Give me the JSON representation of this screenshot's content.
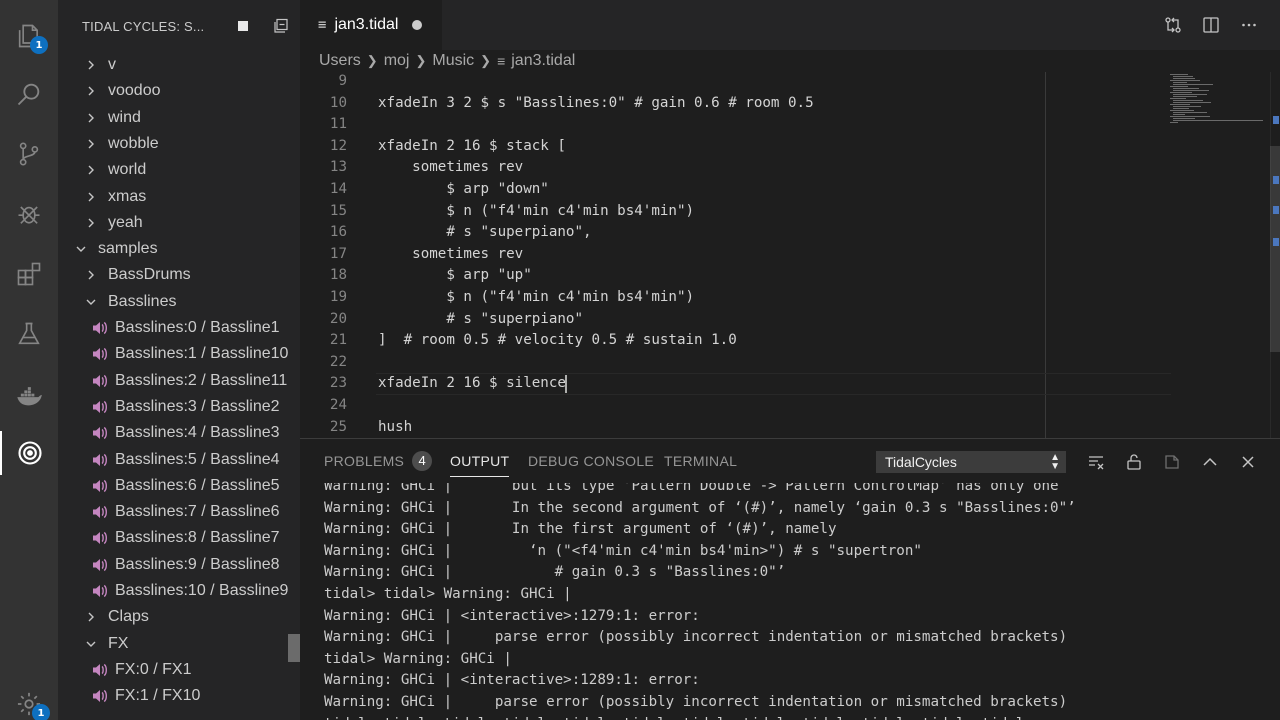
{
  "activity_bar": {
    "explorer_badge": "1",
    "settings_badge": "1",
    "icons": [
      "files-icon",
      "search-icon",
      "source-control-icon",
      "debug-icon",
      "extensions-icon",
      "testing-icon",
      "docker-icon",
      "tidal-icon",
      "settings-icon"
    ]
  },
  "sidebar": {
    "title": "TIDAL CYCLES: S...",
    "items": [
      {
        "label": "v",
        "kind": "folder-collapsed"
      },
      {
        "label": "voodoo",
        "kind": "folder-collapsed"
      },
      {
        "label": "wind",
        "kind": "folder-collapsed"
      },
      {
        "label": "wobble",
        "kind": "folder-collapsed"
      },
      {
        "label": "world",
        "kind": "folder-collapsed"
      },
      {
        "label": "xmas",
        "kind": "folder-collapsed"
      },
      {
        "label": "yeah",
        "kind": "folder-collapsed"
      },
      {
        "label": "samples",
        "kind": "folder-expanded-root"
      },
      {
        "label": "BassDrums",
        "kind": "folder-collapsed"
      },
      {
        "label": "Basslines",
        "kind": "folder-expanded"
      },
      {
        "label": "Basslines:0 / Bassline1",
        "kind": "sound"
      },
      {
        "label": "Basslines:1 / Bassline10",
        "kind": "sound"
      },
      {
        "label": "Basslines:2 / Bassline11",
        "kind": "sound"
      },
      {
        "label": "Basslines:3 / Bassline2",
        "kind": "sound"
      },
      {
        "label": "Basslines:4 / Bassline3",
        "kind": "sound"
      },
      {
        "label": "Basslines:5 / Bassline4",
        "kind": "sound"
      },
      {
        "label": "Basslines:6 / Bassline5",
        "kind": "sound"
      },
      {
        "label": "Basslines:7 / Bassline6",
        "kind": "sound"
      },
      {
        "label": "Basslines:8 / Bassline7",
        "kind": "sound"
      },
      {
        "label": "Basslines:9 / Bassline8",
        "kind": "sound"
      },
      {
        "label": "Basslines:10 / Bassline9",
        "kind": "sound"
      },
      {
        "label": "Claps",
        "kind": "folder-collapsed"
      },
      {
        "label": "FX",
        "kind": "folder-expanded"
      },
      {
        "label": "FX:0 / FX1",
        "kind": "sound"
      },
      {
        "label": "FX:1 / FX10",
        "kind": "sound"
      }
    ]
  },
  "editor": {
    "tab_label": "jan3.tidal",
    "breadcrumbs": [
      "Users",
      "moj",
      "Music",
      "jan3.tidal"
    ],
    "lines": [
      {
        "n": "9",
        "text": ""
      },
      {
        "n": "10",
        "text": "xfadeIn 3 2 $ s \"Basslines:0\" # gain 0.6 # room 0.5"
      },
      {
        "n": "11",
        "text": ""
      },
      {
        "n": "12",
        "text": "xfadeIn 2 16 $ stack ["
      },
      {
        "n": "13",
        "text": "    sometimes rev"
      },
      {
        "n": "14",
        "text": "        $ arp \"down\""
      },
      {
        "n": "15",
        "text": "        $ n (\"f4'min c4'min bs4'min\")"
      },
      {
        "n": "16",
        "text": "        # s \"superpiano\","
      },
      {
        "n": "17",
        "text": "    sometimes rev"
      },
      {
        "n": "18",
        "text": "        $ arp \"up\""
      },
      {
        "n": "19",
        "text": "        $ n (\"f4'min c4'min bs4'min\")"
      },
      {
        "n": "20",
        "text": "        # s \"superpiano\""
      },
      {
        "n": "21",
        "text": "]  # room 0.5 # velocity 0.5 # sustain 1.0"
      },
      {
        "n": "22",
        "text": ""
      },
      {
        "n": "23",
        "text": "xfadeIn 2 16 $ silence"
      },
      {
        "n": "24",
        "text": ""
      },
      {
        "n": "25",
        "text": "hush"
      }
    ]
  },
  "panel": {
    "tabs": {
      "problems": "PROBLEMS",
      "problems_count": "4",
      "output": "OUTPUT",
      "debug_console": "DEBUG CONSOLE",
      "terminal": "TERMINAL"
    },
    "channel": "TidalCycles",
    "output_lines": [
      "Warning: GHCi |       but its type ‘Pattern Double -> Pattern ControlMap’ has only one",
      "Warning: GHCi |       In the second argument of ‘(#)’, namely ‘gain 0.3 s \"Basslines:0\"’",
      "Warning: GHCi |       In the first argument of ‘(#)’, namely",
      "Warning: GHCi |         ‘n (\"<f4'min c4'min bs4'min>\") # s \"supertron\"",
      "Warning: GHCi |            # gain 0.3 s \"Basslines:0\"’",
      "tidal> tidal> Warning: GHCi |",
      "Warning: GHCi | <interactive>:1279:1: error:",
      "Warning: GHCi |     parse error (possibly incorrect indentation or mismatched brackets)",
      "tidal> Warning: GHCi |",
      "Warning: GHCi | <interactive>:1289:1: error:",
      "Warning: GHCi |     parse error (possibly incorrect indentation or mismatched brackets)",
      "tidal> tidal> tidal> tidal> tidal> tidal> tidal> tidal> tidal> tidal> tidal> tidal>"
    ]
  },
  "colors": {
    "accent": "#0e70c0",
    "sound_icon": "#c586c0"
  }
}
